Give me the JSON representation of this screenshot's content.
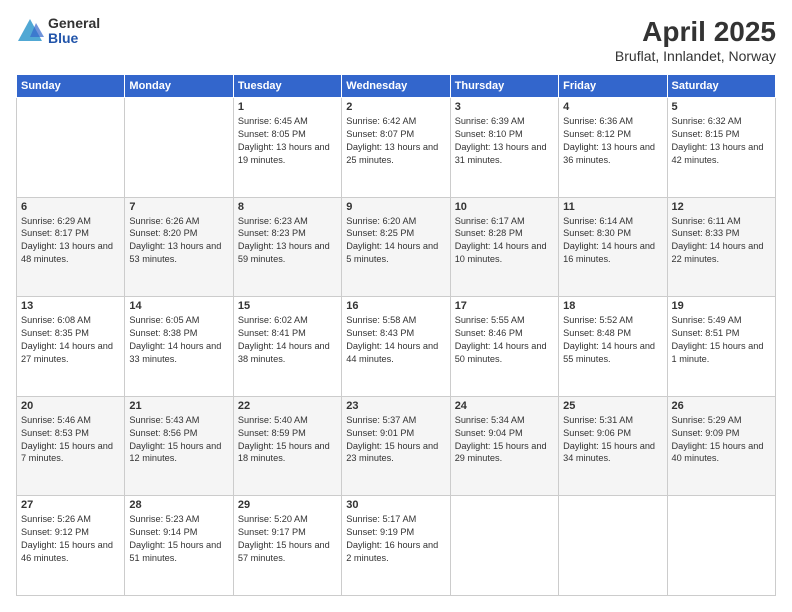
{
  "header": {
    "title": "April 2025",
    "subtitle": "Bruflat, Innlandet, Norway",
    "logo_general": "General",
    "logo_blue": "Blue"
  },
  "days_of_week": [
    "Sunday",
    "Monday",
    "Tuesday",
    "Wednesday",
    "Thursday",
    "Friday",
    "Saturday"
  ],
  "weeks": [
    [
      {
        "day": "",
        "sunrise": "",
        "sunset": "",
        "daylight": ""
      },
      {
        "day": "",
        "sunrise": "",
        "sunset": "",
        "daylight": ""
      },
      {
        "day": "1",
        "sunrise": "Sunrise: 6:45 AM",
        "sunset": "Sunset: 8:05 PM",
        "daylight": "Daylight: 13 hours and 19 minutes."
      },
      {
        "day": "2",
        "sunrise": "Sunrise: 6:42 AM",
        "sunset": "Sunset: 8:07 PM",
        "daylight": "Daylight: 13 hours and 25 minutes."
      },
      {
        "day": "3",
        "sunrise": "Sunrise: 6:39 AM",
        "sunset": "Sunset: 8:10 PM",
        "daylight": "Daylight: 13 hours and 31 minutes."
      },
      {
        "day": "4",
        "sunrise": "Sunrise: 6:36 AM",
        "sunset": "Sunset: 8:12 PM",
        "daylight": "Daylight: 13 hours and 36 minutes."
      },
      {
        "day": "5",
        "sunrise": "Sunrise: 6:32 AM",
        "sunset": "Sunset: 8:15 PM",
        "daylight": "Daylight: 13 hours and 42 minutes."
      }
    ],
    [
      {
        "day": "6",
        "sunrise": "Sunrise: 6:29 AM",
        "sunset": "Sunset: 8:17 PM",
        "daylight": "Daylight: 13 hours and 48 minutes."
      },
      {
        "day": "7",
        "sunrise": "Sunrise: 6:26 AM",
        "sunset": "Sunset: 8:20 PM",
        "daylight": "Daylight: 13 hours and 53 minutes."
      },
      {
        "day": "8",
        "sunrise": "Sunrise: 6:23 AM",
        "sunset": "Sunset: 8:23 PM",
        "daylight": "Daylight: 13 hours and 59 minutes."
      },
      {
        "day": "9",
        "sunrise": "Sunrise: 6:20 AM",
        "sunset": "Sunset: 8:25 PM",
        "daylight": "Daylight: 14 hours and 5 minutes."
      },
      {
        "day": "10",
        "sunrise": "Sunrise: 6:17 AM",
        "sunset": "Sunset: 8:28 PM",
        "daylight": "Daylight: 14 hours and 10 minutes."
      },
      {
        "day": "11",
        "sunrise": "Sunrise: 6:14 AM",
        "sunset": "Sunset: 8:30 PM",
        "daylight": "Daylight: 14 hours and 16 minutes."
      },
      {
        "day": "12",
        "sunrise": "Sunrise: 6:11 AM",
        "sunset": "Sunset: 8:33 PM",
        "daylight": "Daylight: 14 hours and 22 minutes."
      }
    ],
    [
      {
        "day": "13",
        "sunrise": "Sunrise: 6:08 AM",
        "sunset": "Sunset: 8:35 PM",
        "daylight": "Daylight: 14 hours and 27 minutes."
      },
      {
        "day": "14",
        "sunrise": "Sunrise: 6:05 AM",
        "sunset": "Sunset: 8:38 PM",
        "daylight": "Daylight: 14 hours and 33 minutes."
      },
      {
        "day": "15",
        "sunrise": "Sunrise: 6:02 AM",
        "sunset": "Sunset: 8:41 PM",
        "daylight": "Daylight: 14 hours and 38 minutes."
      },
      {
        "day": "16",
        "sunrise": "Sunrise: 5:58 AM",
        "sunset": "Sunset: 8:43 PM",
        "daylight": "Daylight: 14 hours and 44 minutes."
      },
      {
        "day": "17",
        "sunrise": "Sunrise: 5:55 AM",
        "sunset": "Sunset: 8:46 PM",
        "daylight": "Daylight: 14 hours and 50 minutes."
      },
      {
        "day": "18",
        "sunrise": "Sunrise: 5:52 AM",
        "sunset": "Sunset: 8:48 PM",
        "daylight": "Daylight: 14 hours and 55 minutes."
      },
      {
        "day": "19",
        "sunrise": "Sunrise: 5:49 AM",
        "sunset": "Sunset: 8:51 PM",
        "daylight": "Daylight: 15 hours and 1 minute."
      }
    ],
    [
      {
        "day": "20",
        "sunrise": "Sunrise: 5:46 AM",
        "sunset": "Sunset: 8:53 PM",
        "daylight": "Daylight: 15 hours and 7 minutes."
      },
      {
        "day": "21",
        "sunrise": "Sunrise: 5:43 AM",
        "sunset": "Sunset: 8:56 PM",
        "daylight": "Daylight: 15 hours and 12 minutes."
      },
      {
        "day": "22",
        "sunrise": "Sunrise: 5:40 AM",
        "sunset": "Sunset: 8:59 PM",
        "daylight": "Daylight: 15 hours and 18 minutes."
      },
      {
        "day": "23",
        "sunrise": "Sunrise: 5:37 AM",
        "sunset": "Sunset: 9:01 PM",
        "daylight": "Daylight: 15 hours and 23 minutes."
      },
      {
        "day": "24",
        "sunrise": "Sunrise: 5:34 AM",
        "sunset": "Sunset: 9:04 PM",
        "daylight": "Daylight: 15 hours and 29 minutes."
      },
      {
        "day": "25",
        "sunrise": "Sunrise: 5:31 AM",
        "sunset": "Sunset: 9:06 PM",
        "daylight": "Daylight: 15 hours and 34 minutes."
      },
      {
        "day": "26",
        "sunrise": "Sunrise: 5:29 AM",
        "sunset": "Sunset: 9:09 PM",
        "daylight": "Daylight: 15 hours and 40 minutes."
      }
    ],
    [
      {
        "day": "27",
        "sunrise": "Sunrise: 5:26 AM",
        "sunset": "Sunset: 9:12 PM",
        "daylight": "Daylight: 15 hours and 46 minutes."
      },
      {
        "day": "28",
        "sunrise": "Sunrise: 5:23 AM",
        "sunset": "Sunset: 9:14 PM",
        "daylight": "Daylight: 15 hours and 51 minutes."
      },
      {
        "day": "29",
        "sunrise": "Sunrise: 5:20 AM",
        "sunset": "Sunset: 9:17 PM",
        "daylight": "Daylight: 15 hours and 57 minutes."
      },
      {
        "day": "30",
        "sunrise": "Sunrise: 5:17 AM",
        "sunset": "Sunset: 9:19 PM",
        "daylight": "Daylight: 16 hours and 2 minutes."
      },
      {
        "day": "",
        "sunrise": "",
        "sunset": "",
        "daylight": ""
      },
      {
        "day": "",
        "sunrise": "",
        "sunset": "",
        "daylight": ""
      },
      {
        "day": "",
        "sunrise": "",
        "sunset": "",
        "daylight": ""
      }
    ]
  ]
}
